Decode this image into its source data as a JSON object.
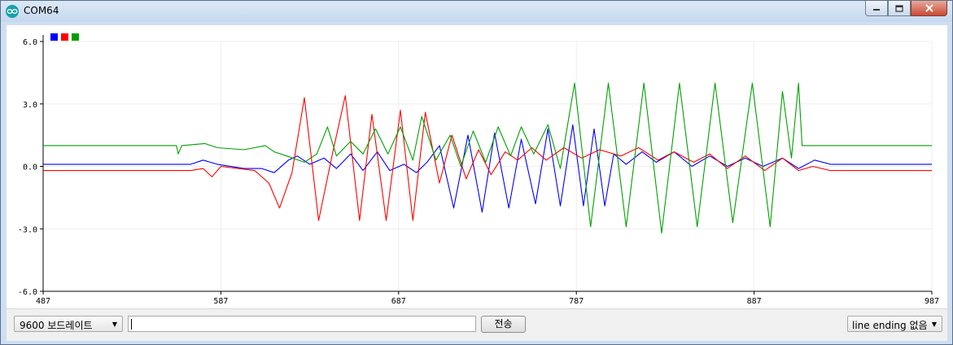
{
  "window": {
    "title": "COM64"
  },
  "toolbar": {
    "baud_select": "9600 보드레이트",
    "message_input_value": "",
    "send_label": "전송",
    "line_ending_select": "line ending 없음"
  },
  "colors": {
    "series1": "#0000ff",
    "series2": "#ff0000",
    "series3": "#00a000"
  },
  "chart_data": {
    "type": "line",
    "y_ticks": [
      "6.0",
      "3.0",
      "0.0",
      "-3.0",
      "-6.0"
    ],
    "x_ticks": [
      "487",
      "587",
      "687",
      "787",
      "887",
      "987"
    ],
    "ylim": [
      -6,
      6
    ],
    "xlim": [
      487,
      987
    ],
    "grid": true,
    "legend": "top-left",
    "series": [
      {
        "color": "#0000ff",
        "points": [
          [
            487,
            0.1
          ],
          [
            560,
            0.1
          ],
          [
            570,
            0.1
          ],
          [
            577,
            0.3
          ],
          [
            585,
            0.1
          ],
          [
            600,
            -0.1
          ],
          [
            610,
            -0.1
          ],
          [
            617,
            -0.3
          ],
          [
            625,
            0.3
          ],
          [
            630,
            0.5
          ],
          [
            637,
            0.1
          ],
          [
            645,
            0.4
          ],
          [
            652,
            -0.1
          ],
          [
            660,
            0.6
          ],
          [
            667,
            -0.2
          ],
          [
            675,
            0.7
          ],
          [
            682,
            -0.2
          ],
          [
            690,
            0.1
          ],
          [
            697,
            -0.3
          ],
          [
            703,
            0.2
          ],
          [
            710,
            1.0
          ],
          [
            718,
            -2.0
          ],
          [
            726,
            1.5
          ],
          [
            734,
            -2.2
          ],
          [
            741,
            1.6
          ],
          [
            749,
            -2.0
          ],
          [
            756,
            1.3
          ],
          [
            764,
            -1.8
          ],
          [
            771,
            1.8
          ],
          [
            778,
            -1.9
          ],
          [
            785,
            2.0
          ],
          [
            791,
            -1.9
          ],
          [
            797,
            1.8
          ],
          [
            803,
            -1.9
          ],
          [
            808,
            0.6
          ],
          [
            815,
            0.1
          ],
          [
            824,
            0.7
          ],
          [
            832,
            0.2
          ],
          [
            842,
            0.7
          ],
          [
            852,
            0.0
          ],
          [
            862,
            0.5
          ],
          [
            872,
            0.0
          ],
          [
            882,
            0.4
          ],
          [
            892,
            0.0
          ],
          [
            903,
            0.4
          ],
          [
            912,
            -0.1
          ],
          [
            921,
            0.3
          ],
          [
            930,
            0.1
          ],
          [
            987,
            0.1
          ]
        ]
      },
      {
        "color": "#ff0000",
        "points": [
          [
            487,
            -0.2
          ],
          [
            570,
            -0.2
          ],
          [
            577,
            -0.1
          ],
          [
            582,
            -0.5
          ],
          [
            587,
            0.0
          ],
          [
            606,
            -0.2
          ],
          [
            614,
            -0.8
          ],
          [
            620,
            -2.0
          ],
          [
            627,
            -0.3
          ],
          [
            634,
            3.3
          ],
          [
            642,
            -2.6
          ],
          [
            650,
            0.7
          ],
          [
            657,
            3.4
          ],
          [
            665,
            -2.6
          ],
          [
            672,
            2.5
          ],
          [
            680,
            -2.6
          ],
          [
            688,
            2.7
          ],
          [
            695,
            -2.6
          ],
          [
            702,
            2.6
          ],
          [
            710,
            -0.8
          ],
          [
            717,
            1.5
          ],
          [
            725,
            -0.6
          ],
          [
            732,
            0.8
          ],
          [
            739,
            -0.4
          ],
          [
            747,
            0.7
          ],
          [
            754,
            0.3
          ],
          [
            762,
            0.9
          ],
          [
            770,
            0.3
          ],
          [
            780,
            0.9
          ],
          [
            790,
            0.4
          ],
          [
            800,
            0.8
          ],
          [
            812,
            0.5
          ],
          [
            822,
            0.9
          ],
          [
            833,
            0.3
          ],
          [
            842,
            0.7
          ],
          [
            853,
            0.2
          ],
          [
            862,
            0.6
          ],
          [
            872,
            -0.1
          ],
          [
            882,
            0.5
          ],
          [
            893,
            -0.2
          ],
          [
            903,
            0.4
          ],
          [
            912,
            -0.2
          ],
          [
            920,
            0.0
          ],
          [
            930,
            -0.2
          ],
          [
            987,
            -0.2
          ]
        ]
      },
      {
        "color": "#00a000",
        "points": [
          [
            487,
            1.0
          ],
          [
            562,
            1.0
          ],
          [
            563,
            0.6
          ],
          [
            565,
            1.0
          ],
          [
            578,
            1.1
          ],
          [
            585,
            0.9
          ],
          [
            600,
            0.8
          ],
          [
            612,
            1.0
          ],
          [
            617,
            0.7
          ],
          [
            624,
            0.5
          ],
          [
            634,
            0.2
          ],
          [
            641,
            0.6
          ],
          [
            647,
            1.9
          ],
          [
            652,
            0.5
          ],
          [
            660,
            1.2
          ],
          [
            667,
            0.6
          ],
          [
            674,
            1.8
          ],
          [
            681,
            0.6
          ],
          [
            688,
            1.9
          ],
          [
            695,
            0.3
          ],
          [
            700,
            2.4
          ],
          [
            708,
            0.3
          ],
          [
            716,
            1.5
          ],
          [
            722,
            0.0
          ],
          [
            729,
            1.7
          ],
          [
            736,
            0.2
          ],
          [
            743,
            1.9
          ],
          [
            750,
            0.5
          ],
          [
            756,
            1.9
          ],
          [
            763,
            0.6
          ],
          [
            771,
            2.0
          ],
          [
            778,
            -0.1
          ],
          [
            786,
            4.0
          ],
          [
            795,
            -2.9
          ],
          [
            805,
            4.0
          ],
          [
            815,
            -2.9
          ],
          [
            825,
            4.0
          ],
          [
            835,
            -3.2
          ],
          [
            845,
            4.0
          ],
          [
            855,
            -2.9
          ],
          [
            865,
            4.0
          ],
          [
            875,
            -2.7
          ],
          [
            886,
            4.0
          ],
          [
            896,
            -2.9
          ],
          [
            903,
            3.6
          ],
          [
            908,
            0.4
          ],
          [
            912,
            4.0
          ],
          [
            914,
            1.0
          ],
          [
            920,
            1.0
          ],
          [
            987,
            1.0
          ]
        ]
      }
    ]
  }
}
